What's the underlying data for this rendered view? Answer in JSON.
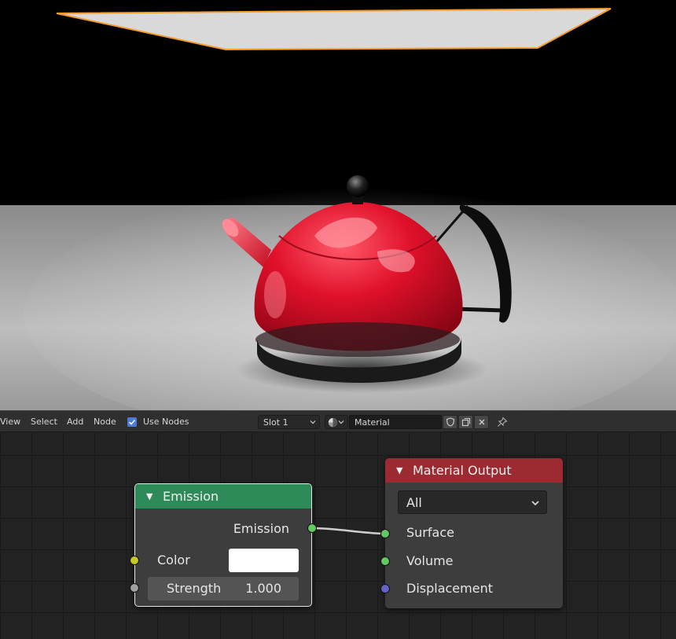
{
  "header": {
    "menus": [
      "View",
      "Select",
      "Add",
      "Node"
    ],
    "use_nodes_label": "Use Nodes",
    "use_nodes_checked": true,
    "slot": "Slot 1",
    "material_name": "Material"
  },
  "nodes": {
    "emission": {
      "title": "Emission",
      "output_label": "Emission",
      "color_label": "Color",
      "color_value": "#ffffff",
      "strength_label": "Strength",
      "strength_value": "1.000",
      "header_color": "#2f8a59"
    },
    "material_output": {
      "title": "Material Output",
      "target": "All",
      "inputs": [
        "Surface",
        "Volume",
        "Displacement"
      ],
      "header_color": "#9c2a31"
    }
  },
  "icons": [
    "checkbox-checked-icon",
    "chevron-down-icon",
    "material-sphere-icon",
    "shield-icon",
    "duplicate-icon",
    "close-icon",
    "pin-icon",
    "collapse-triangle-icon"
  ]
}
